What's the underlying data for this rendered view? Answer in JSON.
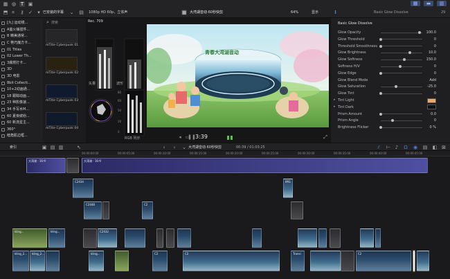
{
  "topbar": {
    "library": "已安装的字幕",
    "format": "1080p HD 60p，立体声",
    "project": "大湾湖音动·60秒快剪",
    "zoom": "64%",
    "view": "显示",
    "inspector_title": "Basic Glow Dissolve",
    "inspector_frame": "29"
  },
  "sidebar": {
    "items": [
      "[九] 运动镜...",
      "A萤火铺插件...",
      "B 精美通常...",
      "C 艳巧魔方卡...",
      "01 Titles",
      "02 Lower Th...",
      "3爆燃打卡...",
      "3D",
      "3D 电影",
      "8bit Collecti...",
      "10+2动画通...",
      "18 跟踪动画...",
      "23 种影像速...",
      "34 手写水M...",
      "60 夏夜缤纷...",
      "60 新流星主...",
      "360°",
      "暗角肌边框..."
    ]
  },
  "browser": {
    "search_placeholder": "搜索",
    "items": [
      {
        "label": "mTitle Cyberpunk 01",
        "color": "#262628"
      },
      {
        "label": "mTitle Cyberpunk 02",
        "color": "#2a2210"
      },
      {
        "label": "mTitle Cyberpunk 03",
        "color": "#101a2e"
      },
      {
        "label": "mTitle Cyberpunk 04",
        "color": "#0e1a2a"
      }
    ]
  },
  "scopes": {
    "rec_label": "Rec. 709",
    "labels": [
      "矢量",
      "波形",
      "RGB 列示"
    ],
    "ticks": [
      "80",
      "60",
      "50",
      "20",
      "0"
    ]
  },
  "viewer": {
    "timecode": "3:39",
    "video_text": "青春大湾湖音动"
  },
  "inspector": {
    "section": "Basic Glow Dissolve",
    "params": [
      {
        "label": "Glow Opacity",
        "value": "100.0",
        "level": 1.0
      },
      {
        "label": "Glow Threshold",
        "value": "0",
        "level": 0.0
      },
      {
        "label": "Threshold Smoothness",
        "value": "0",
        "level": 0.0
      },
      {
        "label": "Glow Brightness",
        "value": "10.0",
        "level": 0.75
      },
      {
        "label": "Glow Softness",
        "value": "150.0",
        "level": 0.6
      },
      {
        "label": "Softness H/V",
        "value": "0",
        "level": 0.5
      },
      {
        "label": "Glow Edge",
        "value": "0",
        "level": 0.0
      },
      {
        "label": "Glow Blend Mode",
        "value": "Add"
      },
      {
        "label": "Glow Saturation",
        "value": "-25.0",
        "level": 0.4
      },
      {
        "label": "Glow Tint",
        "value": "0",
        "level": 0.0
      },
      {
        "label": "Tint Light",
        "swatch": "#f0a868"
      },
      {
        "label": "Tint Dark",
        "swatch": "#111111"
      },
      {
        "label": "Prism Amount",
        "value": "0.0",
        "level": 0.0
      },
      {
        "label": "Prism Angle",
        "value": "0",
        "level": 0.3
      },
      {
        "label": "Brightness Flicker",
        "value": "0 %",
        "level": 0.0
      }
    ]
  },
  "timeline": {
    "index_label": "索引",
    "project": "大湾湖音动·60秒快剪",
    "duration": "00:39 / 01:03:25",
    "ruler": [
      "00:00:00:00",
      "00:00:05:00",
      "00:00:10:00",
      "00:00:15:00",
      "00:00:20:00",
      "00:00:25:00",
      "00:00:30:00",
      "00:00:35:00",
      "00:00:40:00",
      "00:00:45:00"
    ],
    "clip_labels": {
      "music": "大湾湖 · 16-9",
      "c2434": "C2434",
      "c2448": "C2448",
      "c2": "C2",
      "c2432": "C2432",
      "img": "IMG",
      "kling": "kling...",
      "kling2": "kling_2...",
      "kling3": "kling_2...",
      "transit": "Transi"
    }
  },
  "colors": {
    "accent": "#5a8fd8",
    "playhead": "#ffffff",
    "active_icon": "#4f7fe0"
  }
}
